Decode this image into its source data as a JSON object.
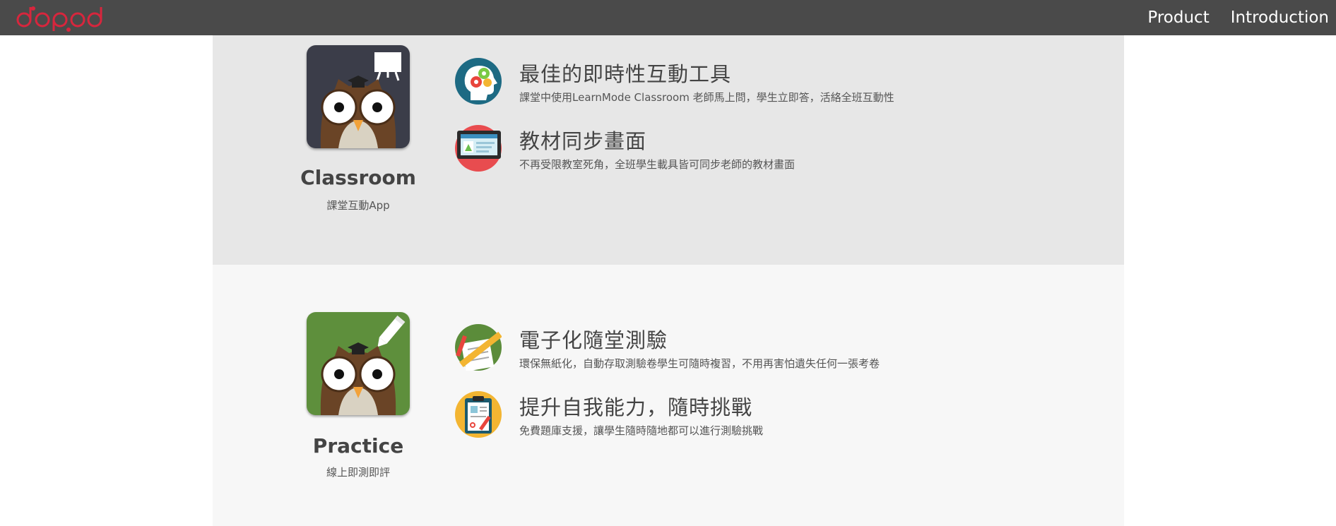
{
  "header": {
    "logo_text": "dopod",
    "nav": [
      {
        "label": "Product"
      },
      {
        "label": "Introduction"
      }
    ]
  },
  "sections": [
    {
      "app_name": "Classroom",
      "app_subtitle": "課堂互動App",
      "app_icon_bg": "#3b3d49",
      "features": [
        {
          "title": "最佳的即時性互動工具",
          "desc": "課堂中使用LearnMode Classroom 老師馬上問，學生立即答，活絡全班互動性",
          "icon": "gears-head-icon"
        },
        {
          "title": "教材同步畫面",
          "desc": "不再受限教室死角，全班學生載具皆可同步老師的教材畫面",
          "icon": "tablet-screen-icon"
        }
      ]
    },
    {
      "app_name": "Practice",
      "app_subtitle": "線上即測即評",
      "app_icon_bg": "#5e8f3c",
      "features": [
        {
          "title": "電子化隨堂測驗",
          "desc": "環保無紙化，自動存取測驗卷學生可隨時複習，不用再害怕遺失任何一張考卷",
          "icon": "pencil-paper-icon"
        },
        {
          "title": "提升自我能力，隨時挑戰",
          "desc": "免費題庫支援，讓學生隨時隨地都可以進行測驗挑戰",
          "icon": "clipboard-icon"
        }
      ]
    }
  ]
}
